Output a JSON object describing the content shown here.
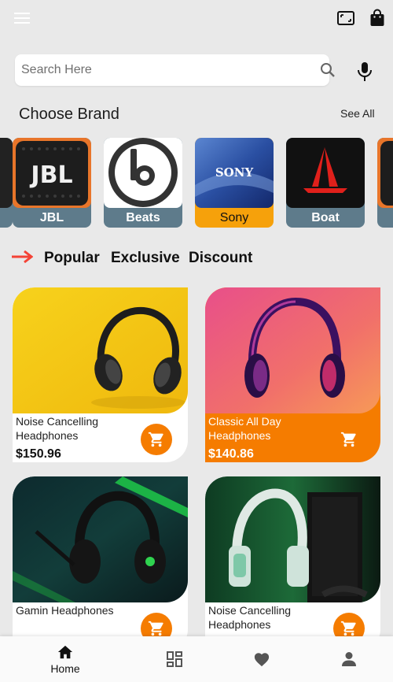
{
  "topbar": {
    "menu_icon": "menu-icon",
    "scan_icon": "scan-icon",
    "bag_icon": "shopping-bag-icon"
  },
  "search": {
    "placeholder": "Search Here",
    "value": "",
    "icon": "search-icon",
    "mic_icon": "mic-icon"
  },
  "brands_section": {
    "title": "Choose Brand",
    "see_all": "See All",
    "brands": [
      {
        "label": "JBL",
        "selected": false
      },
      {
        "label": "Beats",
        "selected": false
      },
      {
        "label": "Sony",
        "selected": true
      },
      {
        "label": "Boat",
        "selected": false
      }
    ]
  },
  "tabs": {
    "arrow_icon": "arrow-right-icon",
    "items": [
      "Popular",
      "Exclusive",
      "Discount"
    ]
  },
  "products": [
    {
      "name": "Noise Cancelling Headphones",
      "price": "$150.96",
      "highlight": false
    },
    {
      "name": "Classic All Day Headphones",
      "price": "$140.86",
      "highlight": true
    },
    {
      "name": "Gamin Headphones",
      "price": "",
      "highlight": false
    },
    {
      "name": "Noise Cancelling Headphones",
      "price": "",
      "highlight": false
    }
  ],
  "bottom_nav": [
    {
      "icon": "home-icon",
      "label": "Home",
      "active": true
    },
    {
      "icon": "dashboard-icon",
      "label": ""
    },
    {
      "icon": "heart-icon",
      "label": ""
    },
    {
      "icon": "person-icon",
      "label": ""
    }
  ],
  "colors": {
    "accent": "#f57c00",
    "selected_brand": "#f6a10b",
    "brand_tile": "#5e7b8b",
    "background": "#e9e9e9",
    "tab_arrow": "#f44336"
  }
}
